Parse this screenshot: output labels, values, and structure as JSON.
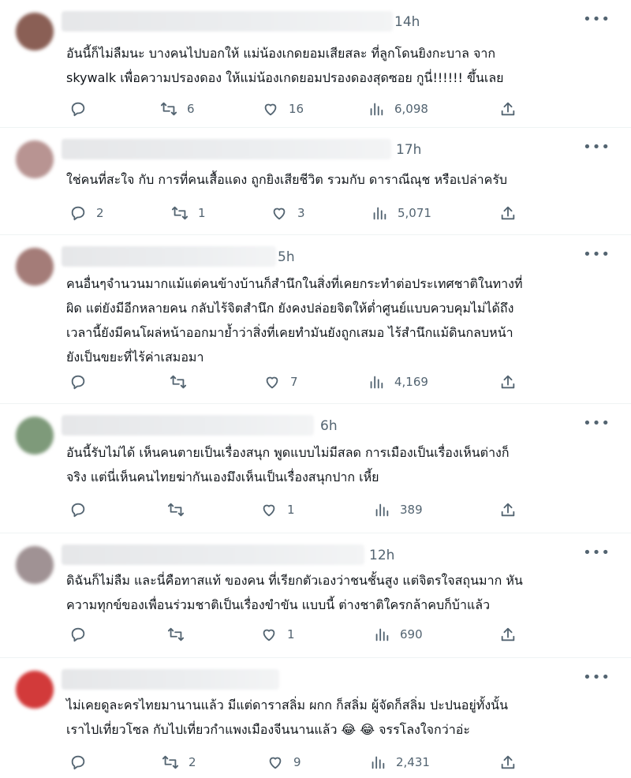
{
  "tweets": [
    {
      "time": "14h",
      "lines": [
        "อันนี้ก็ไม่ลืมนะ บางคนไปบอกให้ แม่น้องเกดยอมเสียสละ ที่ลูกโดนยิงกะบาล จาก",
        "skywalk  เพื่อความปรองดอง ให้แม่น้องเกดยอมปรองดองสุดซอย กูนี่!!!!!! ขึ้นเลย"
      ],
      "replies": "",
      "retweets": "6",
      "likes": "16",
      "views": "6,098"
    },
    {
      "time": "17h",
      "lines": [
        "ใช่คนที่สะใจ กับ การที่คนเสื้อแดง ถูกยิงเสียชีวิต รวมกับ ดาราณีณุช หรือเปล่าครับ"
      ],
      "replies": "2",
      "retweets": "1",
      "likes": "3",
      "views": "5,071"
    },
    {
      "time": "5h",
      "lines": [
        "คนอื่นๆจำนวนมากแม้แต่คนข้างบ้านก็สำนึกในสิ่งที่เคยกระทำต่อประเทศชาติในทางที่",
        "ผิด แต่ยังมีอีกหลายคน กลับไร้จิตสำนึก ยังคงปล่อยจิตให้ต่ำศูนย์แบบควบคุมไม่ได้ถึง",
        "เวลานี้ยังมีคนโผล่หน้าออกมาย้ำว่าสิ่งที่เคยทำมันยังถูกเสมอ ไร้สำนึกแม้ดินกลบหน้า",
        "ยังเป็นขยะที่ไร้ค่าเสมอมา"
      ],
      "replies": "",
      "retweets": "",
      "likes": "7",
      "views": "4,169"
    },
    {
      "time": "6h",
      "lines": [
        "อันนี้รับไม่ได้ เห็นคนตายเป็นเรื่องสนุก พูดแบบไม่มีสลด การเมืองเป็นเรื่องเห็นต่างก็",
        "จริง แต่นี่เห็นคนไทยฆ่ากันเองมึงเห็นเป็นเรื่องสนุกปาก เหี้ย"
      ],
      "replies": "",
      "retweets": "",
      "likes": "1",
      "views": "389"
    },
    {
      "time": "12h",
      "lines": [
        "ดิฉันก็ไม่ลืม และนี่คือทาสแท้ ของคน ที่เรียกตัวเองว่าชนชั้นสูง แต่จิตรใจสถุนมาก หัน",
        "ความทุกข์ของเพื่อนร่วมชาติเป็นเรื่องขำขัน แบบนี้ ต่างชาติใครกล้าคบก็บ้าแล้ว"
      ],
      "replies": "",
      "retweets": "",
      "likes": "1",
      "views": "690"
    },
    {
      "time": "",
      "lines": [
        "ไม่เคยดูละครไทยมานานแล้ว มีแต่ดาราสลิ่ม ผกก ก็สลิ่ม ผู้จัดก็สลิ่ม ปะปนอยู่ทั้งนั้น",
        "เราไปเที่ยวโซล กับไปเที่ยวกำแพงเมืองจีนนานแล้ว 😂 😂 จรรโลงใจกว่าอ่ะ"
      ],
      "replies": "",
      "retweets": "2",
      "likes": "9",
      "views": "2,431"
    }
  ],
  "more_icon": "•••",
  "colors": {
    "text": "#0f1419",
    "secondary": "#536471",
    "divider": "#eff3f4"
  }
}
